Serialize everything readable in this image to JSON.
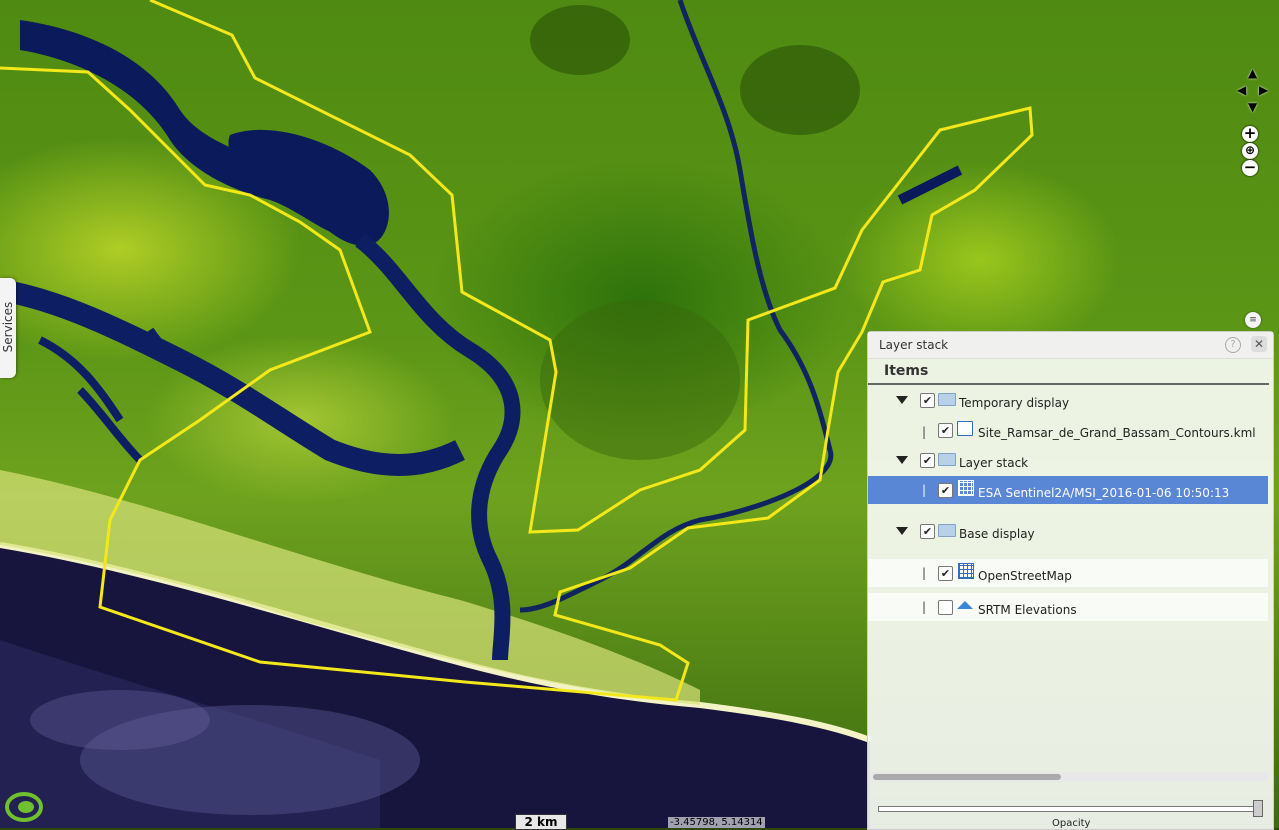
{
  "map": {
    "scale_label": "2 km",
    "coordinates": "-3.45798, 5.14314",
    "credit": ""
  },
  "sidebar": {
    "services_label": "Services"
  },
  "navigation": {
    "pan_up": "▲",
    "pan_left": "◀",
    "pan_right": "▶",
    "pan_down": "▼",
    "zoom_in": "+",
    "zoom_out": "−"
  },
  "layer_panel": {
    "title": "Layer stack",
    "items_heading": "Items",
    "help_label": "?",
    "close_label": "✕",
    "opacity_label": "Opacity",
    "opacity_value": 1.0,
    "groups": [
      {
        "label": "Temporary display",
        "checked": true,
        "layers": [
          {
            "label": "Site_Ramsar_de_Grand_Bassam_Contours.kml",
            "checked": true,
            "icon": "kml-icon"
          }
        ]
      },
      {
        "label": "Layer stack",
        "checked": true,
        "layers": [
          {
            "label": "ESA Sentinel2A/MSI_2016-01-06 10:50:13",
            "checked": true,
            "icon": "grid-icon",
            "selected": true
          }
        ]
      },
      {
        "label": "Base display",
        "checked": true,
        "layers": [
          {
            "label": "OpenStreetMap",
            "checked": true,
            "icon": "grid-icon"
          },
          {
            "label": "SRTM Elevations",
            "checked": false,
            "icon": "elevation-icon"
          }
        ]
      }
    ]
  },
  "colors": {
    "selection": "#5a86d6",
    "boundary_line": "#f4e81a",
    "water": "#0a1b5a",
    "ocean": "#14123a"
  }
}
